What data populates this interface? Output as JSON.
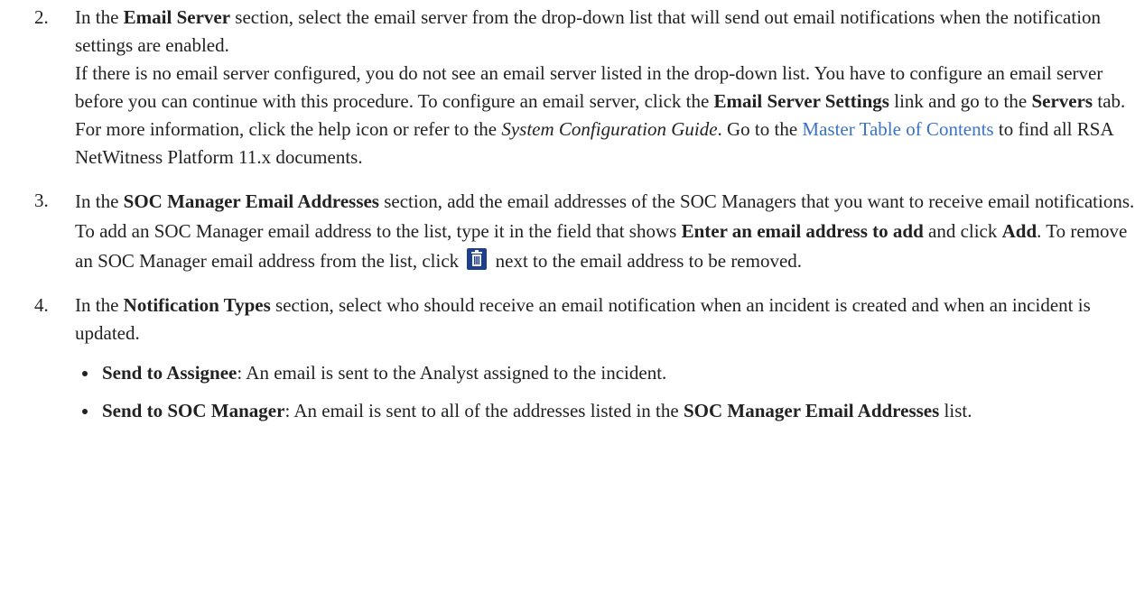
{
  "steps": [
    {
      "number": "2.",
      "lead": "In the ",
      "section": "Email Server",
      "rest": " section, select the email server from the drop-down list that will send out email notifications when the notification settings are enabled.",
      "p2_a": "If there is no email server configured, you do not see an email server listed in the drop-down list. You have to configure an email server before you can continue with this procedure. To configure an email server, click the ",
      "p2_link": "Email Server Settings",
      "p2_b": " link and go to the ",
      "p2_tab": "Servers",
      "p2_c": " tab. For more information, click the help icon or refer to the ",
      "p2_guide": "System Configuration Guide",
      "p2_d": ". Go to the ",
      "p2_master": "Master Table of Contents",
      "p2_e": " to find all RSA NetWitness Platform 11.x documents."
    },
    {
      "number": "3.",
      "lead": "In the ",
      "section": "SOC Manager Email Addresses",
      "rest_a": " section, add the email addresses of the SOC Managers that you want to receive email notifications. To add an SOC Manager email address to the list, type it in the field that shows ",
      "field_text": "Enter an email address to add",
      "rest_b": " and click ",
      "add_label": "Add",
      "rest_c": ". To remove an SOC Manager email address from the list, click ",
      "rest_d": " next to the email address to be removed."
    },
    {
      "number": "4.",
      "lead": "In the ",
      "section": "Notification Types",
      "rest": " section, select who should receive an email notification when an incident is created and when an incident is updated.",
      "bullets": [
        {
          "label": "Send to Assignee",
          "text": ": An email is sent to the Analyst assigned to the incident."
        },
        {
          "label": "Send to SOC Manager",
          "text_a": ": An email is sent to all of the addresses listed in the ",
          "list_name": "SOC Manager Email Addresses",
          "text_b": " list."
        }
      ]
    }
  ],
  "colors": {
    "text": "#222222",
    "link": "#3b73c4",
    "icon_body": "#1d3f8c",
    "icon_lid": "#f2f2f2"
  },
  "icons": {
    "delete": "trash-icon"
  }
}
